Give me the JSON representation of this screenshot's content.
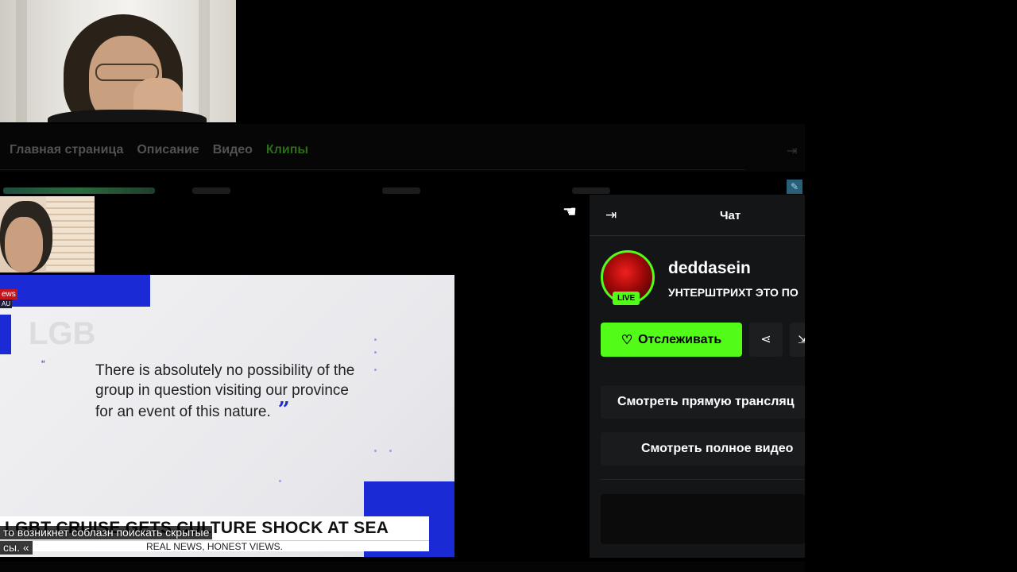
{
  "tabs": [
    {
      "label": "Главная страница",
      "active": false
    },
    {
      "label": "Описание",
      "active": false
    },
    {
      "label": "Видео",
      "active": false
    },
    {
      "label": "Клипы",
      "active": true
    }
  ],
  "news": {
    "logo_top": "ews",
    "logo_bottom": "AU",
    "quote": "There is absolutely no possibility of the group in question visiting our province for an event of this nature.",
    "headline": "LGBT CRUISE GETS CULTURE SHOCK AT SEA",
    "subheadline": "REAL NEWS, HONEST VIEWS.",
    "caption_line1": "то возникнет соблазн поискать скрытые",
    "caption_line2": "сы. «"
  },
  "chat": {
    "title": "Чат",
    "channel_name": "deddasein",
    "live_badge": "LIVE",
    "stream_title": "УНТЕРШТРИХТ ЭТО ПО",
    "follow_label": "Отслеживать",
    "watch_live_label": "Смотреть прямую трансляц",
    "watch_full_label": "Смотреть полное видео"
  },
  "colors": {
    "accent_green": "#53fc18",
    "panel_bg": "#141516",
    "news_blue": "#1a2bd6"
  },
  "icons": [
    "collapse-icon",
    "heart-icon",
    "share-icon",
    "external-icon",
    "hand-cursor-icon",
    "pin-icon"
  ]
}
